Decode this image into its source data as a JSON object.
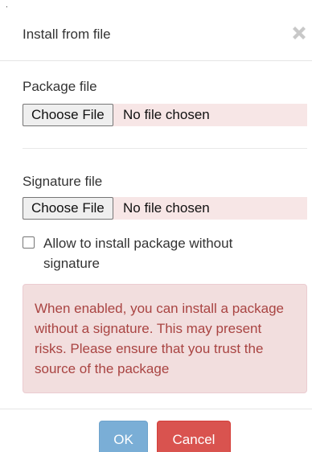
{
  "dialog": {
    "title": "Install from file",
    "close_icon": "close-icon"
  },
  "package_file": {
    "label": "Package file",
    "button_label": "Choose File",
    "status": "No file chosen"
  },
  "signature_file": {
    "label": "Signature file",
    "button_label": "Choose File",
    "status": "No file chosen"
  },
  "allow_unsigned": {
    "label": "Allow to install package without signature",
    "checked": false
  },
  "warning": {
    "text": "When enabled, you can install a package without a signature. This may present risks. Please ensure that you trust the source of the package"
  },
  "footer": {
    "ok_label": "OK",
    "cancel_label": "Cancel"
  },
  "colors": {
    "ok_button": "#7aaed6",
    "cancel_button": "#d9534f",
    "alert_background": "#f2dede",
    "alert_text": "#a94442",
    "file_row_background": "#f7e6e6"
  }
}
